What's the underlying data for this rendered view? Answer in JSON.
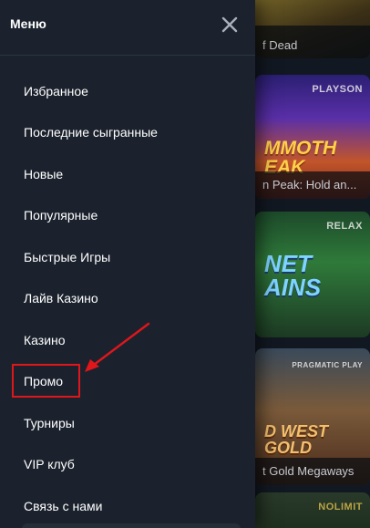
{
  "menu": {
    "title": "Меню",
    "close_icon": "close-icon",
    "items": [
      {
        "label": "Избранное"
      },
      {
        "label": "Последние сыгранные"
      },
      {
        "label": "Новые"
      },
      {
        "label": "Популярные"
      },
      {
        "label": "Быстрые Игры"
      },
      {
        "label": "Лайв Казино"
      },
      {
        "label": "Казино"
      },
      {
        "label": "Промо"
      },
      {
        "label": "Турниры"
      },
      {
        "label": "VIP клуб"
      },
      {
        "label": "Связь с нами"
      }
    ]
  },
  "games": [
    {
      "caption": "f Dead",
      "provider": ""
    },
    {
      "caption": "n Peak: Hold an...",
      "provider": "PLAYSON",
      "art": "MMOTH EAK"
    },
    {
      "caption": "",
      "provider": "RELAX",
      "art": "NET AINS"
    },
    {
      "caption": "t Gold Megaways",
      "provider": "PRAGMATIC PLAY",
      "art": "D WEST GOLD"
    },
    {
      "caption": "",
      "provider": "NOLIMIT"
    }
  ],
  "colors": {
    "drawer_bg": "#1b222d",
    "page_bg": "#0f141d",
    "highlight": "#e0161b"
  }
}
